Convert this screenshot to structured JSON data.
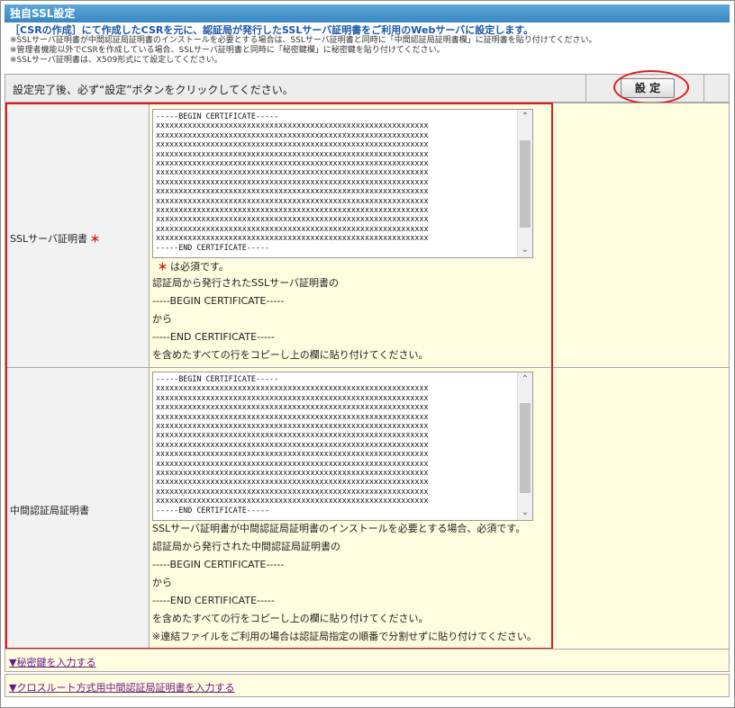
{
  "title": "独自SSL設定",
  "intro": {
    "lead": "［CSRの作成］にて作成したCSRを元に、認証局が発行したSSLサーバ証明書をご利用のWebサーバに設定します。",
    "notes": [
      "※SSLサーバ証明書が中間認証局証明書のインストールを必要とする場合は、SSLサーバ証明書と同時に「中間認証局証明書欄」に証明書を貼り付けてください。",
      "※管理者機能以外でCSRを作成している場合、SSLサーバ証明書と同時に「秘密鍵欄」に秘密鍵を貼り付けてください。",
      "※SSLサーバ証明書は、X509形式にて設定してください。"
    ]
  },
  "set_bar": {
    "text": "設定完了後、必ず“設定”ボタンをクリックしてください。",
    "button": "設 定"
  },
  "ssl_cert": {
    "label": "SSLサーバ証明書",
    "required_mark": "＊",
    "textarea": "-----BEGIN CERTIFICATE-----\nxxxxxxxxxxxxxxxxxxxxxxxxxxxxxxxxxxxxxxxxxxxxxxxxxxxxxxxxxxxx\nxxxxxxxxxxxxxxxxxxxxxxxxxxxxxxxxxxxxxxxxxxxxxxxxxxxxxxxxxxxx\nxxxxxxxxxxxxxxxxxxxxxxxxxxxxxxxxxxxxxxxxxxxxxxxxxxxxxxxxxxxx\nxxxxxxxxxxxxxxxxxxxxxxxxxxxxxxxxxxxxxxxxxxxxxxxxxxxxxxxxxxxx\nxxxxxxxxxxxxxxxxxxxxxxxxxxxxxxxxxxxxxxxxxxxxxxxxxxxxxxxxxxxx\nxxxxxxxxxxxxxxxxxxxxxxxxxxxxxxxxxxxxxxxxxxxxxxxxxxxxxxxxxxxx\nxxxxxxxxxxxxxxxxxxxxxxxxxxxxxxxxxxxxxxxxxxxxxxxxxxxxxxxxxxxx\nxxxxxxxxxxxxxxxxxxxxxxxxxxxxxxxxxxxxxxxxxxxxxxxxxxxxxxxxxxxx\nxxxxxxxxxxxxxxxxxxxxxxxxxxxxxxxxxxxxxxxxxxxxxxxxxxxxxxxxxxxx\nxxxxxxxxxxxxxxxxxxxxxxxxxxxxxxxxxxxxxxxxxxxxxxxxxxxxxxxxxxxx\nxxxxxxxxxxxxxxxxxxxxxxxxxxxxxxxxxxxxxxxxxxxxxxxxxxxxxxxxxxxx\nxxxxxxxxxxxxxxxxxxxxxxxxxxxxxxxxxxxxxxxxxxxxxxxxxxxxxxxxxxxx\nxxxxxxxxxxxxxxxxxxxxxxxxxxxxxxxxxxxxxxxxxxxxxxxxxxxxxxxxxxxx\n-----END CERTIFICATE-----",
    "required_note_mark": "＊",
    "required_note": "は必須です。",
    "help": [
      "認証局から発行されたSSLサーバ証明書の",
      "-----BEGIN CERTIFICATE-----",
      "から",
      "-----END CERTIFICATE-----",
      "を含めたすべての行をコピーし上の欄に貼り付けてください。"
    ]
  },
  "intermediate_cert": {
    "label": "中間認証局証明書",
    "textarea": "-----BEGIN CERTIFICATE-----\nxxxxxxxxxxxxxxxxxxxxxxxxxxxxxxxxxxxxxxxxxxxxxxxxxxxxxxxxxxxx\nxxxxxxxxxxxxxxxxxxxxxxxxxxxxxxxxxxxxxxxxxxxxxxxxxxxxxxxxxxxx\nxxxxxxxxxxxxxxxxxxxxxxxxxxxxxxxxxxxxxxxxxxxxxxxxxxxxxxxxxxxx\nxxxxxxxxxxxxxxxxxxxxxxxxxxxxxxxxxxxxxxxxxxxxxxxxxxxxxxxxxxxx\nxxxxxxxxxxxxxxxxxxxxxxxxxxxxxxxxxxxxxxxxxxxxxxxxxxxxxxxxxxxx\nxxxxxxxxxxxxxxxxxxxxxxxxxxxxxxxxxxxxxxxxxxxxxxxxxxxxxxxxxxxx\nxxxxxxxxxxxxxxxxxxxxxxxxxxxxxxxxxxxxxxxxxxxxxxxxxxxxxxxxxxxx\nxxxxxxxxxxxxxxxxxxxxxxxxxxxxxxxxxxxxxxxxxxxxxxxxxxxxxxxxxxxx\nxxxxxxxxxxxxxxxxxxxxxxxxxxxxxxxxxxxxxxxxxxxxxxxxxxxxxxxxxxxx\nxxxxxxxxxxxxxxxxxxxxxxxxxxxxxxxxxxxxxxxxxxxxxxxxxxxxxxxxxxxx\nxxxxxxxxxxxxxxxxxxxxxxxxxxxxxxxxxxxxxxxxxxxxxxxxxxxxxxxxxxxx\nxxxxxxxxxxxxxxxxxxxxxxxxxxxxxxxxxxxxxxxxxxxxxxxxxxxxxxxxxxxx\nxxxxxxxxxxxxxxxxxxxxxxxxxxxxxxxxxxxxxxxxxxxxxxxxxxxxxxxxxxxx\n-----END CERTIFICATE-----",
    "help": [
      "SSLサーバ証明書が中間認証局証明書のインストールを必要とする場合、必須です。",
      "認証局から発行された中間認証局証明書の",
      "-----BEGIN CERTIFICATE-----",
      "から",
      "-----END CERTIFICATE-----",
      "を含めたすべての行をコピーし上の欄に貼り付けてください。",
      "※連結ファイルをご利用の場合は認証局指定の順番で分割せずに貼り付けてください。"
    ]
  },
  "links": {
    "private_key": "▼秘密鍵を入力する",
    "cross_root": "▼クロスルート方式用中間認証局証明書を入力する"
  },
  "colors": {
    "title_bar": "#3a87c2",
    "lead_text": "#1a56a8",
    "highlight": "#e01b1b",
    "field_bg": "#fffde0"
  }
}
